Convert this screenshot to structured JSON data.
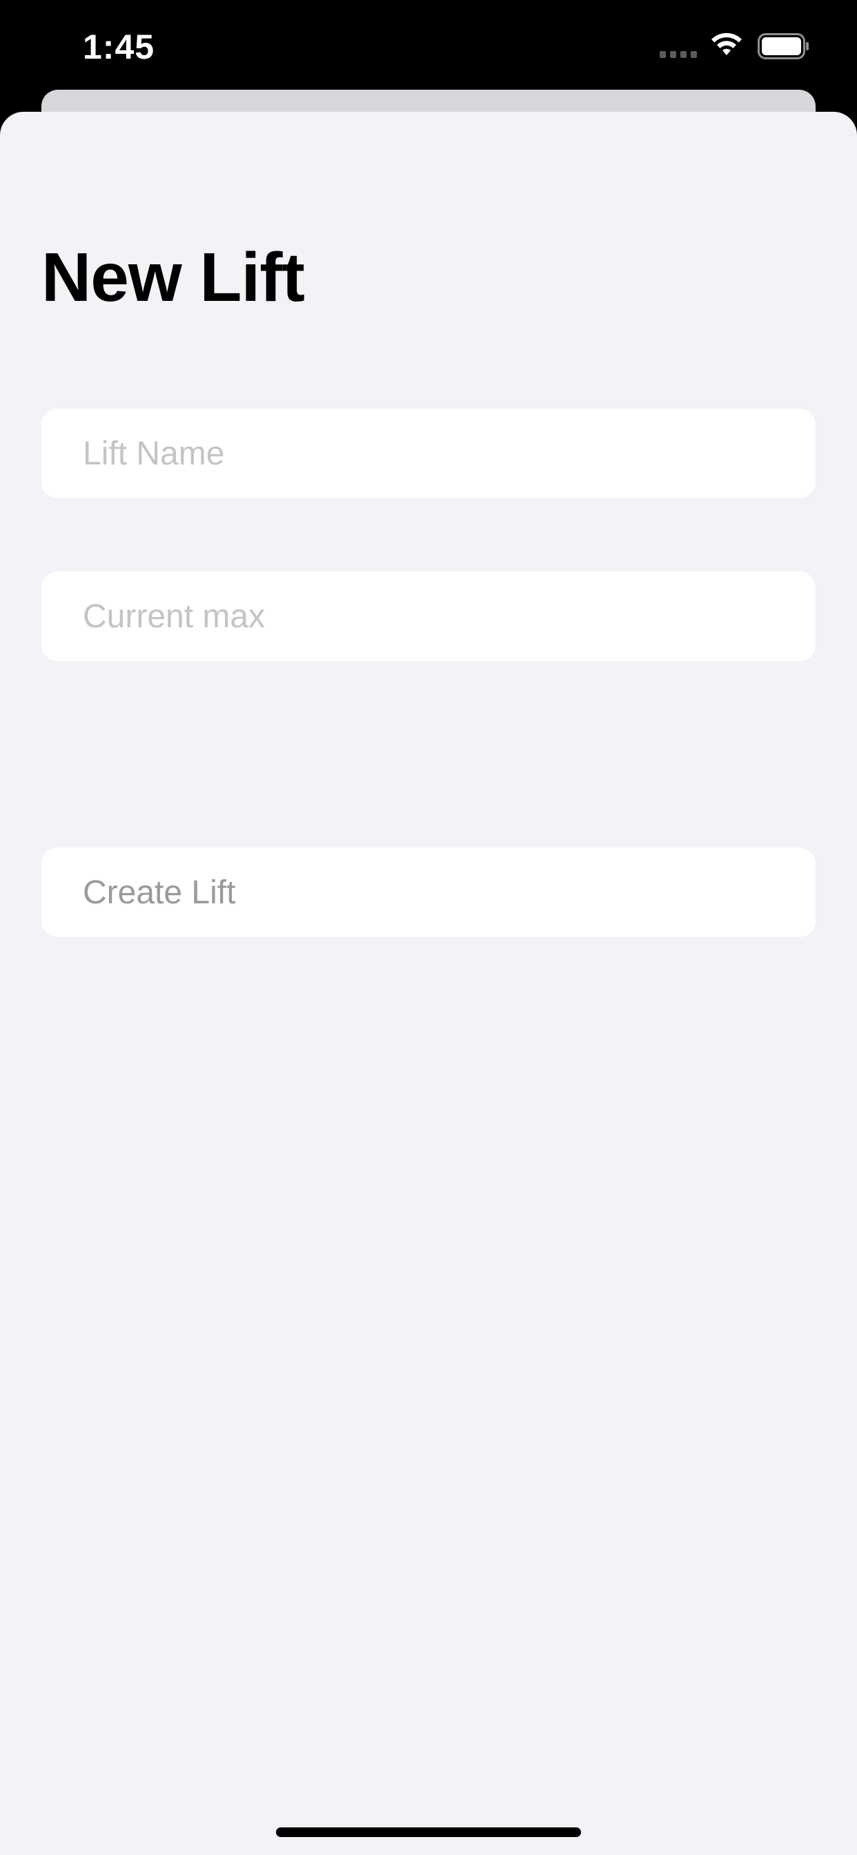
{
  "status_bar": {
    "time": "1:45"
  },
  "icons": {
    "signal": "cellular-signal-icon",
    "wifi": "wifi-icon",
    "battery": "battery-icon"
  },
  "sheet": {
    "title": "New Lift",
    "lift_name_field": {
      "value": "",
      "placeholder": "Lift Name"
    },
    "current_max_field": {
      "value": "",
      "placeholder": "Current max"
    },
    "create_button_label": "Create Lift"
  },
  "colors": {
    "sheet_background": "#f2f2f7",
    "placeholder_text": "#c4c4c7",
    "disabled_button_text": "#9a9a9e"
  }
}
